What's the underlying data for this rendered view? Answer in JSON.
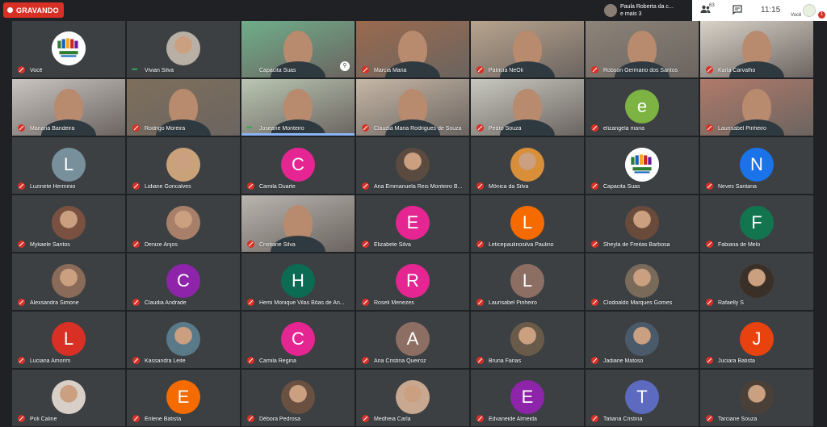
{
  "recording": {
    "label": "GRAVANDO"
  },
  "presenter": {
    "line1": "Paula Roberta da c...",
    "line2": "e mais 3"
  },
  "controls": {
    "people_icon": "people-icon",
    "people_count": "63",
    "chat_icon": "chat-icon",
    "time": "11:15",
    "you_label": "Você",
    "notification_count": "1"
  },
  "tiles": [
    {
      "name": "Você",
      "kind": "logo",
      "col": 0,
      "row": 0,
      "mic": "muted"
    },
    {
      "name": "Vivian Silva",
      "kind": "photo",
      "col": 1,
      "row": 0,
      "mic": "speaking",
      "color": "#b9b0a5"
    },
    {
      "name": "Capacita Suas",
      "kind": "video",
      "col": 2,
      "row": 0,
      "mic": "none",
      "color": "#6fae8a",
      "pin": true
    },
    {
      "name": "Marcia Maria",
      "kind": "video",
      "col": 3,
      "row": 0,
      "mic": "muted",
      "color": "#9a6a4e"
    },
    {
      "name": "Patricia NeOli",
      "kind": "video",
      "col": 4,
      "row": 0,
      "mic": "muted",
      "color": "#b8a48e"
    },
    {
      "name": "Robson Germano dos Santos",
      "kind": "video",
      "col": 5,
      "row": 0,
      "mic": "muted",
      "color": "#8c8478"
    },
    {
      "name": "Karla Carvalho",
      "kind": "video",
      "col": 6,
      "row": 0,
      "mic": "muted",
      "color": "#d8d2c8"
    },
    {
      "name": "Mariana Bandeira",
      "kind": "video",
      "col": 0,
      "row": 1,
      "mic": "muted",
      "color": "#c9c4c0"
    },
    {
      "name": "Rodrigo Moreira",
      "kind": "video",
      "col": 1,
      "row": 1,
      "mic": "muted",
      "color": "#7e6f5c"
    },
    {
      "name": "Joseane Monteiro",
      "kind": "video",
      "col": 2,
      "row": 1,
      "mic": "speaking",
      "color": "#b9c6b2",
      "active": true
    },
    {
      "name": "Cláudia Maria Rodrigues de Souza",
      "kind": "video",
      "col": 3,
      "row": 1,
      "mic": "muted",
      "color": "#c6b7a6"
    },
    {
      "name": "Pedro Souza",
      "kind": "video",
      "col": 4,
      "row": 1,
      "mic": "muted",
      "color": "#c8c8c0"
    },
    {
      "name": "elizangela maria",
      "kind": "letter",
      "letter": "e",
      "col": 5,
      "row": 1,
      "mic": "muted",
      "color": "#7cb342"
    },
    {
      "name": "Laurisabel Pinheiro",
      "kind": "video",
      "col": 6,
      "row": 1,
      "mic": "muted",
      "color": "#b07a6a"
    },
    {
      "name": "Luzinete Herminio",
      "kind": "letter",
      "letter": "L",
      "col": 0,
      "row": 2,
      "mic": "muted",
      "color": "#78909c"
    },
    {
      "name": "Lidiane Goncalves",
      "kind": "avatar-photo",
      "col": 1,
      "row": 2,
      "mic": "muted",
      "color": "#c9a27a"
    },
    {
      "name": "Camila Duarte",
      "kind": "letter",
      "letter": "C",
      "col": 2,
      "row": 2,
      "mic": "muted",
      "color": "#e52592"
    },
    {
      "name": "Ana Emmanuela Reis Monteiro B...",
      "kind": "avatar-photo",
      "col": 3,
      "row": 2,
      "mic": "muted",
      "color": "#5a4a40"
    },
    {
      "name": "Mônica da Silva",
      "kind": "avatar-photo",
      "col": 4,
      "row": 2,
      "mic": "muted",
      "color": "#d98e3a"
    },
    {
      "name": "Capacita Suas",
      "kind": "avatar-logo",
      "col": 5,
      "row": 2,
      "mic": "muted"
    },
    {
      "name": "Neves Santana",
      "kind": "letter",
      "letter": "N",
      "col": 6,
      "row": 2,
      "mic": "muted",
      "color": "#1a73e8"
    },
    {
      "name": "Mykaele Santos",
      "kind": "avatar-photo",
      "col": 0,
      "row": 3,
      "mic": "muted",
      "color": "#7a5040"
    },
    {
      "name": "Denize Anjos",
      "kind": "avatar-photo",
      "col": 1,
      "row": 3,
      "mic": "muted",
      "color": "#a8806a"
    },
    {
      "name": "Cristiane Silva",
      "kind": "video",
      "col": 2,
      "row": 3,
      "mic": "muted",
      "color": "#b8b4ae"
    },
    {
      "name": "Elizabete Silva",
      "kind": "letter",
      "letter": "E",
      "col": 3,
      "row": 3,
      "mic": "muted",
      "color": "#e52592"
    },
    {
      "name": "Leticepaulinosilva Paulino",
      "kind": "letter",
      "letter": "L",
      "col": 4,
      "row": 3,
      "mic": "muted",
      "color": "#f56b00"
    },
    {
      "name": "Sheyla de Freitas Barbosa",
      "kind": "avatar-photo",
      "col": 5,
      "row": 3,
      "mic": "muted",
      "color": "#6a4a3a"
    },
    {
      "name": "Fabiana de Melo",
      "kind": "letter",
      "letter": "F",
      "col": 6,
      "row": 3,
      "mic": "muted",
      "color": "#12754f"
    },
    {
      "name": "Alexsandra Simone",
      "kind": "avatar-photo",
      "col": 0,
      "row": 4,
      "mic": "muted",
      "color": "#8a6a58"
    },
    {
      "name": "Claudia Andrade",
      "kind": "letter",
      "letter": "C",
      "col": 1,
      "row": 4,
      "mic": "muted",
      "color": "#8e24aa"
    },
    {
      "name": "Hemi Monique Vilas Bôas de An...",
      "kind": "letter",
      "letter": "H",
      "col": 2,
      "row": 4,
      "mic": "muted",
      "color": "#0b6b53"
    },
    {
      "name": "Roseli Menezes",
      "kind": "letter",
      "letter": "R",
      "col": 3,
      "row": 4,
      "mic": "muted",
      "color": "#e52592"
    },
    {
      "name": "Laurisabel Pinheiro",
      "kind": "letter",
      "letter": "L",
      "col": 4,
      "row": 4,
      "mic": "muted",
      "color": "#8d6e63"
    },
    {
      "name": "Clodoaldo Marques Gomes",
      "kind": "avatar-photo",
      "col": 5,
      "row": 4,
      "mic": "muted",
      "color": "#7a6a5a"
    },
    {
      "name": "Rafaelly S",
      "kind": "avatar-photo",
      "col": 6,
      "row": 4,
      "mic": "muted",
      "color": "#3a3028"
    },
    {
      "name": "Luciana Amorim",
      "kind": "letter",
      "letter": "L",
      "col": 0,
      "row": 5,
      "mic": "muted",
      "color": "#d93025"
    },
    {
      "name": "Kassandra Leite",
      "kind": "avatar-photo",
      "col": 1,
      "row": 5,
      "mic": "muted",
      "color": "#5a7a8a"
    },
    {
      "name": "Camila Regina",
      "kind": "letter",
      "letter": "C",
      "col": 2,
      "row": 5,
      "mic": "muted",
      "color": "#e52592"
    },
    {
      "name": "Ana Cristina Queiroz",
      "kind": "letter",
      "letter": "A",
      "col": 3,
      "row": 5,
      "mic": "muted",
      "color": "#8d6e63"
    },
    {
      "name": "Bruna Farias",
      "kind": "avatar-photo",
      "col": 4,
      "row": 5,
      "mic": "muted",
      "color": "#6a5a4a"
    },
    {
      "name": "Jadiane Matoso",
      "kind": "avatar-photo",
      "col": 5,
      "row": 5,
      "mic": "muted",
      "color": "#4a5a6a"
    },
    {
      "name": "Juciara Batista",
      "kind": "letter",
      "letter": "J",
      "col": 6,
      "row": 5,
      "mic": "muted",
      "color": "#e8430e"
    },
    {
      "name": "Poli Caline",
      "kind": "avatar-photo",
      "col": 0,
      "row": 6,
      "mic": "muted",
      "color": "#d8d0c8"
    },
    {
      "name": "Erilene Batista",
      "kind": "letter",
      "letter": "E",
      "col": 1,
      "row": 6,
      "mic": "muted",
      "color": "#f56b00"
    },
    {
      "name": "Débora Pedrosa",
      "kind": "avatar-photo",
      "col": 2,
      "row": 6,
      "mic": "muted",
      "color": "#6a5040"
    },
    {
      "name": "Medheia Carla",
      "kind": "avatar-photo",
      "col": 3,
      "row": 6,
      "mic": "muted",
      "color": "#c8a890"
    },
    {
      "name": "Edvaneide Almeida",
      "kind": "letter",
      "letter": "E",
      "col": 4,
      "row": 6,
      "mic": "muted",
      "color": "#8e24aa"
    },
    {
      "name": "Tatiana Cristina",
      "kind": "letter",
      "letter": "T",
      "col": 5,
      "row": 6,
      "mic": "muted",
      "color": "#5c6bc0"
    },
    {
      "name": "Tarciane Souza",
      "kind": "avatar-photo",
      "col": 6,
      "row": 6,
      "mic": "muted",
      "color": "#4a4038"
    }
  ]
}
